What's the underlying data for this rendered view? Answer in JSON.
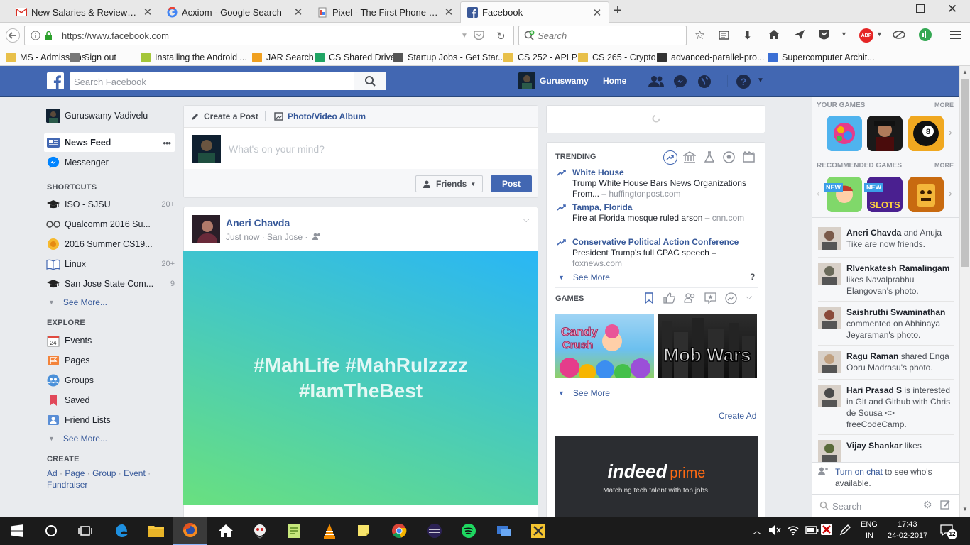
{
  "browser": {
    "tabs": [
      {
        "title": "New Salaries & Reviews: Q...",
        "icon": "gmail-icon"
      },
      {
        "title": "Acxiom - Google Search",
        "icon": "google-icon"
      },
      {
        "title": "Pixel - The First Phone by ...",
        "icon": "pixel-doc-icon"
      },
      {
        "title": "Facebook",
        "icon": "facebook-icon"
      }
    ],
    "new_tab": "+",
    "url": "https://www.facebook.com",
    "search_placeholder": "Search",
    "bookmarks": [
      {
        "label": "MS - Admissions",
        "icon": "folder-icon",
        "color": "#e8c04a"
      },
      {
        "label": "Sign out",
        "icon": "globe-icon",
        "color": "#777777"
      },
      {
        "label": "Installing the Android ...",
        "icon": "android-icon",
        "color": "#a4c639"
      },
      {
        "label": "JAR Search",
        "icon": "jar-icon",
        "color": "#f0a020"
      },
      {
        "label": "CS Shared Drive",
        "icon": "drive-icon",
        "color": "#1fa463"
      },
      {
        "label": "Startup Jobs - Get Star...",
        "icon": "victory-icon",
        "color": "#555555"
      },
      {
        "label": "CS 252 - APLP",
        "icon": "folder-icon",
        "color": "#e8c04a"
      },
      {
        "label": "CS 265 - Crypto",
        "icon": "folder-icon",
        "color": "#e8c04a"
      },
      {
        "label": "advanced-parallel-pro...",
        "icon": "github-icon",
        "color": "#333333"
      },
      {
        "label": "Supercomputer Archit...",
        "icon": "supercomputer-icon",
        "color": "#3b6fd4"
      }
    ],
    "ext_badge": "ABP"
  },
  "fb": {
    "search_placeholder": "Search Facebook",
    "user_short": "Guruswamy",
    "home": "Home",
    "colors": {
      "header": "#4267b2",
      "link": "#365899",
      "bg": "#e9ebee"
    }
  },
  "left": {
    "profile_name": "Guruswamy Vadivelu",
    "feed_items": [
      {
        "label": "News Feed",
        "icon": "news-feed-icon",
        "more": "•••"
      },
      {
        "label": "Messenger",
        "icon": "messenger-icon"
      }
    ],
    "shortcuts_title": "SHORTCUTS",
    "shortcuts": [
      {
        "label": "ISO - SJSU",
        "count": "20+",
        "icon": "graduation-cap-icon"
      },
      {
        "label": "Qualcomm 2016 Su...",
        "count": "",
        "icon": "glasses-icon"
      },
      {
        "label": "2016 Summer CS19...",
        "count": "",
        "icon": "flower-icon"
      },
      {
        "label": "Linux",
        "count": "20+",
        "icon": "book-icon"
      },
      {
        "label": "San Jose State Com...",
        "count": "9",
        "icon": "graduation-cap-icon"
      }
    ],
    "see_more": "See More...",
    "explore_title": "EXPLORE",
    "explore": [
      {
        "label": "Events",
        "icon": "calendar-icon",
        "badge": "24"
      },
      {
        "label": "Pages",
        "icon": "flag-icon"
      },
      {
        "label": "Groups",
        "icon": "groups-icon"
      },
      {
        "label": "Saved",
        "icon": "bookmark-icon"
      },
      {
        "label": "Friend Lists",
        "icon": "friend-list-icon"
      }
    ],
    "create_title": "CREATE",
    "create_links": [
      "Ad",
      "Page",
      "Group",
      "Event",
      "Fundraiser"
    ]
  },
  "composer": {
    "tab_post": "Create a Post",
    "tab_album": "Photo/Video Album",
    "placeholder": "What's on your mind?",
    "audience": "Friends",
    "post_button": "Post"
  },
  "post": {
    "author": "Aneri Chavda",
    "meta": "Just now · San Jose ·",
    "text_line1": "#MahLife #MahRulzzzz",
    "text_line2": "#IamTheBest",
    "gradient_start": "#29b6f6",
    "gradient_end": "#69e07f"
  },
  "trending": {
    "title": "TRENDING",
    "items": [
      {
        "topic": "White House",
        "headline": "Trump White House Bars News Organizations From...",
        "source": "– huffingtonpost.com"
      },
      {
        "topic": "Tampa, Florida",
        "headline": "Fire at Florida mosque ruled arson –",
        "source": "cnn.com"
      },
      {
        "topic": "Conservative Political Action Conference",
        "headline": "President Trump's full CPAC speech –",
        "source": "foxnews.com"
      }
    ],
    "see_more": "See More",
    "help": "?"
  },
  "games": {
    "title": "GAMES",
    "tiles": [
      {
        "name": "Candy Crush Saga"
      },
      {
        "name": "Mob Wars"
      }
    ],
    "see_more": "See More",
    "create_ad": "Create Ad",
    "ad_brand": "indeed",
    "ad_brand2": "prime",
    "ad_tagline": "Matching tech talent with top jobs."
  },
  "right": {
    "your_games": "YOUR GAMES",
    "more": "MORE",
    "recommended": "RECOMMENDED GAMES",
    "new_badge": "NEW",
    "ticker": [
      {
        "name": "Aneri Chavda",
        "rest": " and Anuja Tike are now friends."
      },
      {
        "name": "RIvenkatesh Ramalingam",
        "rest": " likes Navalprabhu Elangovan's photo."
      },
      {
        "name": "Saishruthi Swaminathan",
        "rest": " commented on Abhinaya Jeyaraman's photo."
      },
      {
        "name": "Ragu Raman",
        "rest": " shared Enga Ooru Madrasu's photo."
      },
      {
        "name": "Hari Prasad S",
        "rest": " is interested in Git and Github with Chris de Sousa <> freeCodeCamp."
      },
      {
        "name": "Vijay Shankar",
        "rest": " likes"
      }
    ],
    "chat_link": "Turn on chat",
    "chat_rest": " to see who's available.",
    "chat_search": "Search"
  },
  "taskbar": {
    "lang1": "ENG",
    "lang2": "IN",
    "time": "17:43",
    "date": "24-02-2017",
    "notif": "12"
  }
}
